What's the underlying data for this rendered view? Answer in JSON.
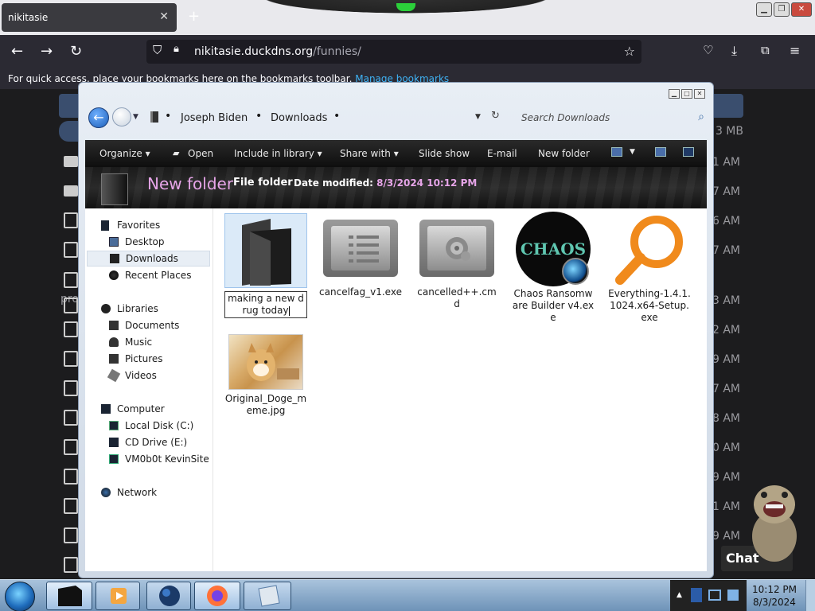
{
  "browser": {
    "tab_title": "nikitasie",
    "tab_close": "✕",
    "new_tab": "+",
    "url_host": "nikitasie.duckdns.org",
    "url_path": "/funnies/",
    "bookmarks_text": "For quick access, place your bookmarks here on the bookmarks toolbar.",
    "bookmarks_link": "Manage bookmarks"
  },
  "background_page": {
    "size_top": "3 MB",
    "times": [
      "1 AM",
      "7 AM",
      "6 AM",
      "7 AM",
      "3 AM",
      "2 AM",
      "9 AM",
      "7 AM",
      "8 AM",
      "0 AM",
      "9 AM",
      "1 AM",
      "9 AM"
    ],
    "partial_text": "pro"
  },
  "explorer": {
    "breadcrumbs": [
      "Joseph Biden",
      "Downloads"
    ],
    "search_placeholder": "Search Downloads",
    "toolbar": {
      "organize": "Organize",
      "open": "Open",
      "include_in_library": "Include in library",
      "share_with": "Share with",
      "slide_show": "Slide show",
      "email": "E-mail",
      "new_folder": "New folder"
    },
    "details": {
      "name": "New folder",
      "type": "File folder",
      "date_label": "Date modified:",
      "date_value": "8/3/2024 10:12 PM"
    },
    "nav": {
      "favorites": "Favorites",
      "desktop": "Desktop",
      "downloads": "Downloads",
      "recent_places": "Recent Places",
      "libraries": "Libraries",
      "documents": "Documents",
      "music": "Music",
      "pictures": "Pictures",
      "videos": "Videos",
      "computer": "Computer",
      "local_disk": "Local Disk (C:)",
      "cd_drive": "CD Drive (E:)",
      "vm_share": "VM0b0t KevinSite",
      "network": "Network"
    },
    "files": {
      "new_folder_rename": "making a new drug today",
      "cancelfag": "cancelfag_v1.exe",
      "cancelled": "cancelled++.cmd",
      "chaos": "Chaos Ransomware Builder v4.exe",
      "chaos_logo": "CHAOS",
      "everything": "Everything-1.4.1.1024.x64-Setup.exe",
      "doge": "Original_Doge_meme.jpg"
    }
  },
  "taskbar": {
    "time": "10:12 PM",
    "date": "8/3/2024"
  },
  "overlay": {
    "chat": "Chat"
  }
}
